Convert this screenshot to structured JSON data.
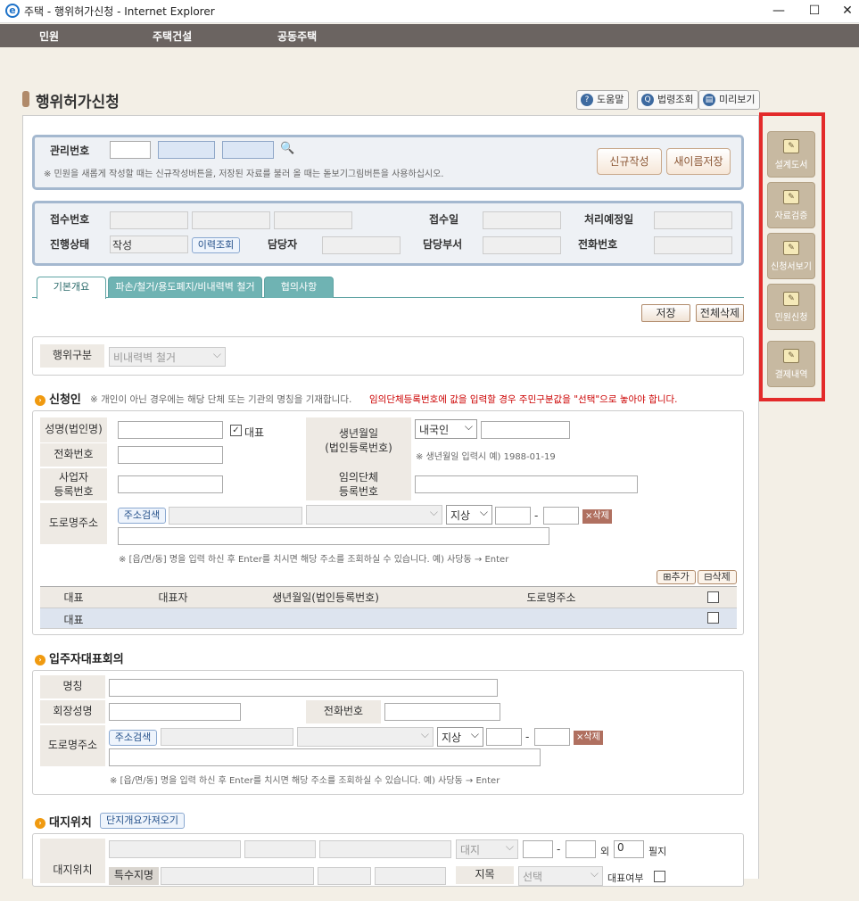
{
  "window": {
    "title": "주택 - 행위허가신청 - Internet Explorer",
    "ie_glyph": "e",
    "min": "—",
    "max": "☐",
    "close": "✕"
  },
  "nav": [
    "민원",
    "주택건설",
    "공동주택"
  ],
  "page": {
    "title": "행위허가신청"
  },
  "toolbar": {
    "help": "도움말",
    "law": "법령조회",
    "preview": "미리보기"
  },
  "mgmt": {
    "label": "관리번호",
    "note": "※ 민원을 새롭게 작성할 때는 신규작성버튼을, 저장된 자료를 불러 올 때는 돋보기그림버튼을 사용하십시오.",
    "new_btn": "신규작성",
    "saveas_btn": "새이름저장",
    "search_icon": "🔍"
  },
  "receipt": {
    "receipt_no": "접수번호",
    "receipt_date": "접수일",
    "due_date": "처리예정일",
    "status_label": "진행상태",
    "status_value": "작성",
    "history_btn": "이력조회",
    "manager": "담당자",
    "dept": "담당부서",
    "phone": "전화번호"
  },
  "tabs": [
    "기본개요",
    "파손/철거/용도폐지/비내력벽 철거",
    "협의사항"
  ],
  "actions": {
    "save": "저장",
    "delete_all": "전체삭제"
  },
  "act_type": {
    "label": "행위구분",
    "value": "비내력벽 철거"
  },
  "applicant": {
    "title": "신청인",
    "note_a": "※ 개인이 아닌 경우에는 해당 단체 또는 기관의 명칭을 기재합니다.",
    "note_b": "임의단체등록번호에 값을 입력할 경우 주민구분값을 \"선택\"으로 놓아야 합니다.",
    "name_label": "성명(법인명)",
    "rep_label": "대표",
    "rep_check": "✓",
    "birth_label_1": "생년월일",
    "birth_label_2": "(법인등록번호)",
    "resident_type": "내국인",
    "birth_note": "※ 생년월일 입력시 예) 1988-01-19",
    "phone_label": "전화번호",
    "biz_label_1": "사업자",
    "biz_label_2": "등록번호",
    "org_label_1": "임의단체",
    "org_label_2": "등록번호",
    "road_label": "도로명주소",
    "addr_search": "주소검색",
    "ground": "지상",
    "dash": "-",
    "x_delete": "×삭제",
    "addr_note": "※ [읍/면/동] 명을 입력 하신 후 Enter를 치시면 해당 주소를 조회하실 수 있습니다. 예) 사당동 → Enter",
    "add_btn": "⊞추가",
    "del_btn": "⊟삭제",
    "table_headers": [
      "대표",
      "대표자",
      "생년월일(법인등록번호)",
      "도로명주소"
    ],
    "row_value": "대표"
  },
  "resident_rep": {
    "title": "입주자대표회의",
    "name": "명칭",
    "chair": "회장성명",
    "phone": "전화번호",
    "road": "도로명주소",
    "addr_search": "주소검색",
    "ground": "지상",
    "dash": "-",
    "x_delete": "×삭제",
    "addr_note": "※ [읍/면/동] 명을 입력 하신 후 Enter를 치시면 해당 주소를 조회하실 수 있습니다. 예) 사당동 → Enter"
  },
  "site": {
    "title": "대지위치",
    "import_btn": "단지개요가져오기",
    "label": "대지위치",
    "land_type": "대지",
    "outside": "외",
    "lot_count": "0",
    "lot_unit": "필지",
    "special": "특수지명",
    "jimok": "지목",
    "select": "선택",
    "rep_yn": "대표여부"
  },
  "side": {
    "design": "설계도서",
    "verify": "자료검증",
    "preview": "신청서보기",
    "apply": "민원신청",
    "payment": "결제내역",
    "icon": "✎"
  },
  "colors": {
    "highlight": "#e32a2a",
    "accent_brown": "#8a5533",
    "blue_border": "#a4b8cf",
    "tab_teal": "#5fa3a3"
  }
}
